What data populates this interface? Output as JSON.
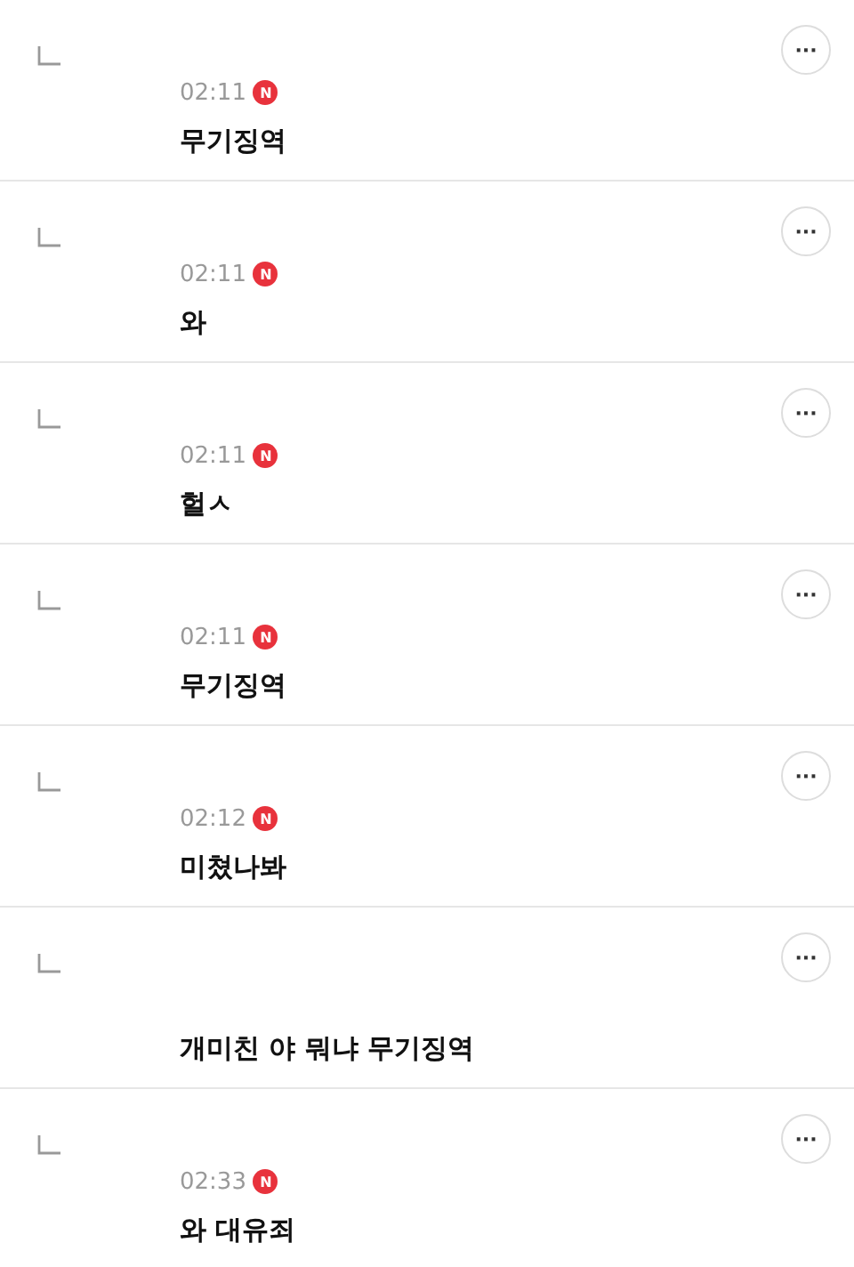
{
  "comments": [
    {
      "time": "02:11",
      "badge": "N",
      "text": "무기징역"
    },
    {
      "time": "02:11",
      "badge": "N",
      "text": "와"
    },
    {
      "time": "02:11",
      "badge": "N",
      "text": "헐ㅅ"
    },
    {
      "time": "02:11",
      "badge": "N",
      "text": "무기징역"
    },
    {
      "time": "02:12",
      "badge": "N",
      "text": "미쳤나봐"
    },
    {
      "text": "개미친 야 뭐냐 무기징역"
    },
    {
      "time": "02:33",
      "badge": "N",
      "text": "와 대유죄"
    }
  ],
  "more_button": {
    "label": "···"
  }
}
